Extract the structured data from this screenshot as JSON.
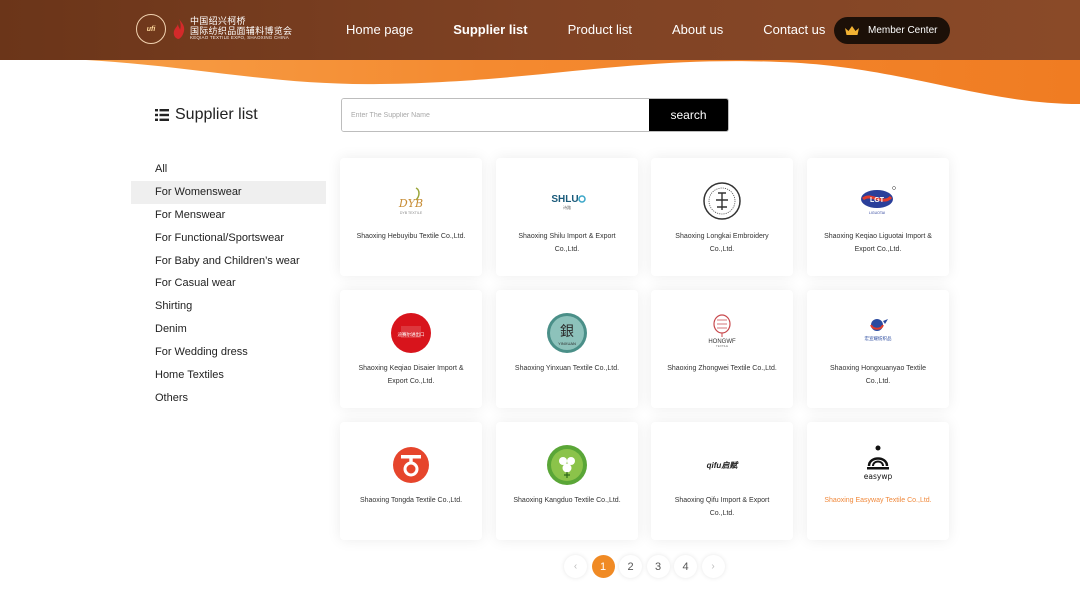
{
  "header": {
    "logo": {
      "badge": "ufi",
      "line1": "中国绍兴柯桥",
      "line2": "国际纺织品面辅料博览会",
      "line3": "KEQIAO TEXTILE EXPO, SHAOXING CHINA"
    },
    "nav": [
      {
        "label": "Home page",
        "active": false
      },
      {
        "label": "Supplier list",
        "active": true
      },
      {
        "label": "Product list",
        "active": false
      },
      {
        "label": "About us",
        "active": false
      },
      {
        "label": "Contact us",
        "active": false
      }
    ],
    "member_label": "Member Center"
  },
  "sidebar": {
    "title": "Supplier list",
    "categories": [
      {
        "label": "All",
        "active": false
      },
      {
        "label": "For Womenswear",
        "active": true
      },
      {
        "label": "For Menswear",
        "active": false
      },
      {
        "label": "For Functional/Sportswear",
        "active": false
      },
      {
        "label": "For Baby and Children’s wear",
        "active": false
      },
      {
        "label": "For Casual wear",
        "active": false
      },
      {
        "label": "Shirting",
        "active": false
      },
      {
        "label": "Denim",
        "active": false
      },
      {
        "label": "For Wedding dress",
        "active": false
      },
      {
        "label": "Home Textiles",
        "active": false
      },
      {
        "label": "Others",
        "active": false
      }
    ]
  },
  "search": {
    "placeholder": "Enter The Supplier Name",
    "button_label": "search"
  },
  "suppliers": [
    {
      "name": "Shaoxing Hebuyibu Textile Co.,Ltd.",
      "logo": "dyb-textile-logo",
      "logo_text": "DYB",
      "sub": "DYB TEXTILE"
    },
    {
      "name": "Shaoxing Shilu Import & Export Co.,Ltd.",
      "logo": "shlu-logo",
      "logo_text": "SHLU",
      "sub": "诗路"
    },
    {
      "name": "Shaoxing Longkai Embroidery Co.,Ltd.",
      "logo": "longkai-seal-logo",
      "logo_text": "",
      "sub": ""
    },
    {
      "name": "Shaoxing Keqiao Liguotai Import & Export Co.,Ltd.",
      "logo": "liguotai-logo",
      "logo_text": "LGT",
      "sub": "LIGUOTAI"
    },
    {
      "name": "Shaoxing Keqiao Disaier Import & Export Co.,Ltd.",
      "logo": "disaier-logo",
      "logo_text": "迪赛尔进出口",
      "sub": ""
    },
    {
      "name": "Shaoxing Yinxuan Textile Co.,Ltd.",
      "logo": "yinxuan-logo",
      "logo_text": "銀",
      "sub": "YINXUAN"
    },
    {
      "name": "Shaoxing Zhongwei Textile Co.,Ltd.",
      "logo": "hongwf-logo",
      "logo_text": "HONGWF",
      "sub": "TEXTILE"
    },
    {
      "name": "Shaoxing Hongxuanyao Textile Co.,Ltd.",
      "logo": "hongxuanyao-logo",
      "logo_text": "宏宣耀纺织品",
      "sub": ""
    },
    {
      "name": "Shaoxing Tongda Textile Co.,Ltd.",
      "logo": "tongda-logo",
      "logo_text": "TD",
      "sub": ""
    },
    {
      "name": "Shaoxing Kangduo Textile Co.,Ltd.",
      "logo": "kangduo-logo",
      "logo_text": "",
      "sub": ""
    },
    {
      "name": "Shaoxing Qifu Import & Export Co.,Ltd.",
      "logo": "qifu-logo",
      "logo_text": "qifu启赋",
      "sub": ""
    },
    {
      "name": "Shaoxing Easyway Textile Co.,Ltd.",
      "logo": "easyway-logo",
      "logo_text": "easywp",
      "sub": "",
      "highlight": true
    }
  ],
  "pagination": {
    "prev": "‹",
    "next": "›",
    "pages": [
      "1",
      "2",
      "3",
      "4"
    ],
    "current": "1"
  },
  "colors": {
    "header_brown": "#7a3d20",
    "accent_orange": "#f08a24",
    "member_btn": "#1c1008"
  }
}
